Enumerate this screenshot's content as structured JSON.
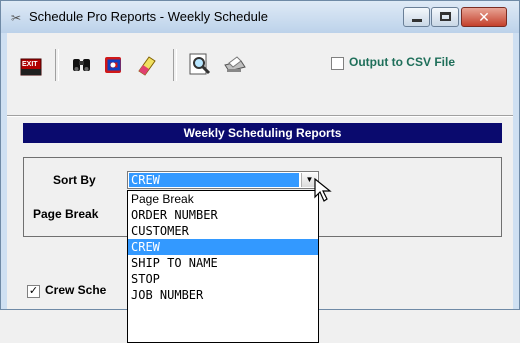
{
  "window": {
    "title": "Schedule Pro Reports - Weekly Schedule",
    "app_icon": "scissors-icon",
    "close_glyph": "✕"
  },
  "toolbar": {
    "items": [
      "exit-icon",
      "binoculars-icon",
      "refresh-icon",
      "eraser-icon",
      "print-preview-icon",
      "printer-icon"
    ],
    "exit_text": "EXIT",
    "csv_option": {
      "label": "Output to CSV File",
      "checked": false
    }
  },
  "banner": {
    "title": "Weekly Scheduling Reports"
  },
  "form": {
    "sort_by_label": "Sort By",
    "sort_by_value": "CREW",
    "page_break_label": "Page Break",
    "combo_arrow": "▼",
    "dropdown_options": [
      "Page Break",
      "ORDER NUMBER",
      "CUSTOMER",
      "CREW",
      "SHIP TO NAME",
      "STOP",
      "JOB NUMBER"
    ],
    "selected_index": 3
  },
  "crew_schedule": {
    "label": "Crew Sche",
    "checked": true,
    "check_glyph": "✓"
  },
  "colors": {
    "banner_bg": "#0a0a6e",
    "selection": "#3399ff",
    "csv_label": "#1f6f5a"
  }
}
